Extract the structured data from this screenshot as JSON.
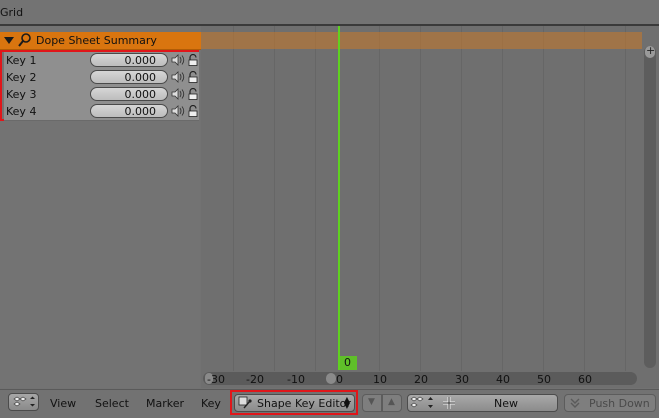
{
  "top_header": {
    "label": "Grid"
  },
  "channels": {
    "summary_label": "Dope Sheet Summary",
    "keys": [
      {
        "name": "Key 1",
        "value": "0.000"
      },
      {
        "name": "Key 2",
        "value": "0.000"
      },
      {
        "name": "Key 3",
        "value": "0.000"
      },
      {
        "name": "Key 4",
        "value": "0.000"
      }
    ]
  },
  "timeline": {
    "current_frame": "0",
    "ticks": [
      "-30",
      "-20",
      "-10",
      "0",
      "10",
      "20",
      "30",
      "40",
      "50",
      "60"
    ]
  },
  "header": {
    "menus": {
      "view": "View",
      "select": "Select",
      "marker": "Marker",
      "key": "Key"
    },
    "mode": "Shape Key Editor",
    "new_action": "New",
    "push_down": "Push Down"
  },
  "colors": {
    "summary_row": "#d9750f",
    "playhead": "#5fd21f",
    "highlight_box": "#e0161a"
  }
}
